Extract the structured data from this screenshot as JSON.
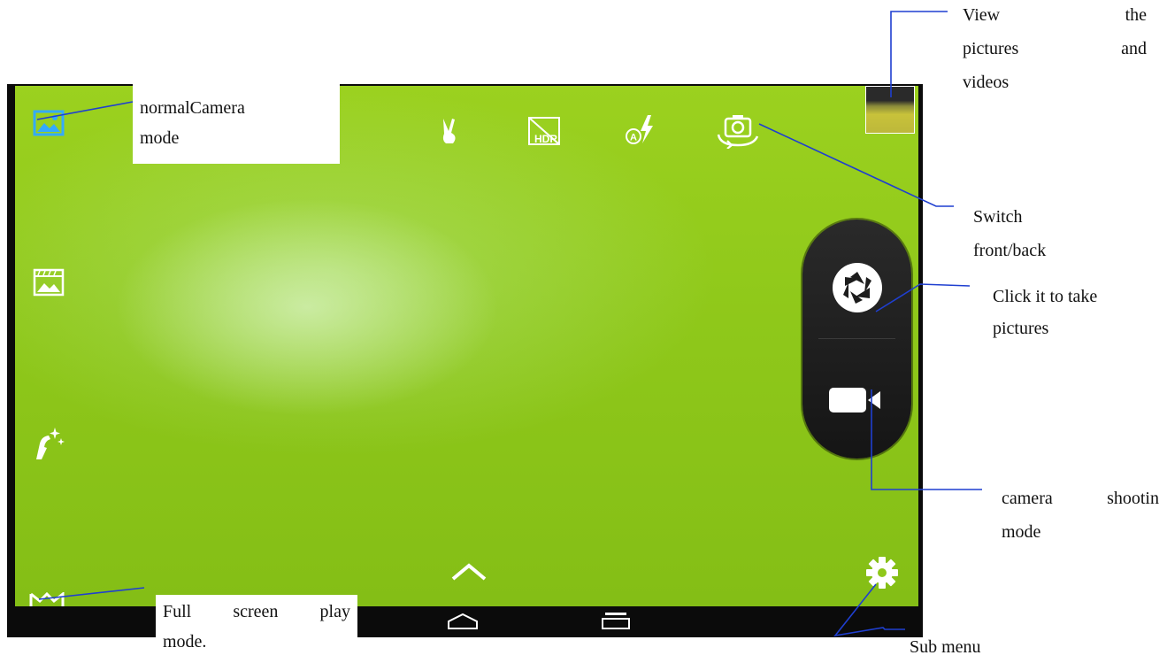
{
  "callouts": {
    "view_pictures": [
      "View",
      "the",
      "pictures",
      "and",
      "videos"
    ],
    "normal_camera": [
      "normalCamera",
      "mode"
    ],
    "switch_camera": [
      "Switch",
      "front/back"
    ],
    "take_pictures": [
      "Click it to take",
      "pictures"
    ],
    "camera_shooting": [
      "camera",
      "shootin",
      "mode"
    ],
    "full_screen": [
      "Full",
      "screen",
      "play",
      "mode."
    ],
    "sub_menu": "Sub menu"
  },
  "toolbar": {
    "icons": [
      "gesture-icon",
      "hdr-icon",
      "flash-auto-icon",
      "switch-camera-icon"
    ],
    "hdr_text": "HDR",
    "flash_text": "A"
  },
  "colors": {
    "viewfinder_green": "#8fc81a",
    "annotation_line": "#1f3fd0",
    "mode_icon_active": "#33aaff",
    "shutter_panel": "#1c1c1c"
  }
}
